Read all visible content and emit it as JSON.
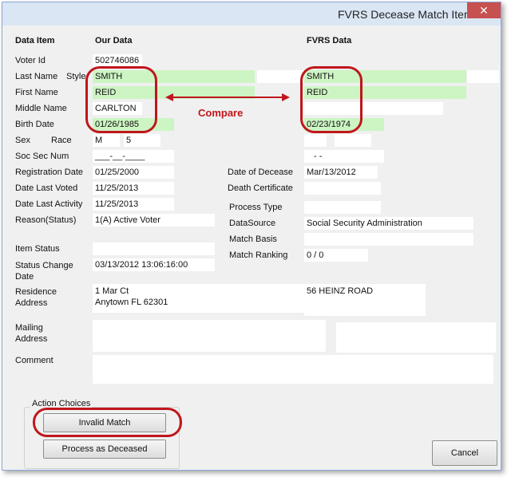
{
  "window": {
    "title": "FVRS Decease Match Item",
    "close_glyph": "✕"
  },
  "headers": {
    "data_item": "Data Item",
    "our_data": "Our Data",
    "fvrs_data": "FVRS Data"
  },
  "labels": {
    "voter_id": "Voter Id",
    "last_name": "Last Name",
    "style": "Style",
    "first_name": "First Name",
    "middle_name": "Middle Name",
    "birth_date": "Birth Date",
    "sex": "Sex",
    "race": "Race",
    "ssn": "Soc Sec Num",
    "registration_date": "Registration Date",
    "date_last_voted": "Date Last Voted",
    "date_last_activity": "Date Last Activity",
    "reason_status": "Reason(Status)",
    "item_status": "Item Status",
    "status_change_date": "Status Change Date",
    "residence_address": "Residence Address",
    "mailing_address": "Mailing Address",
    "comment": "Comment",
    "date_of_decease": "Date of Decease",
    "death_certificate": "Death Certificate",
    "process_type": "Process Type",
    "data_source": "DataSource",
    "match_basis": "Match Basis",
    "match_ranking": "Match Ranking"
  },
  "our": {
    "voter_id": "502746086",
    "last_name": "SMITH",
    "first_name": "REID",
    "middle_name": "CARLTON",
    "birth_date": "01/26/1985",
    "sex": "M",
    "race": "5",
    "ssn": "___-__-____",
    "registration_date": "01/25/2000",
    "date_last_voted": "11/25/2013",
    "date_last_activity": "11/25/2013",
    "reason_status": "1(A) Active Voter",
    "status_change_date": "03/13/2012 13:06:16:00",
    "residence_line1": "1 Mar Ct",
    "residence_line2": "Anytown FL 62301"
  },
  "fvrs": {
    "last_name": "SMITH",
    "first_name": "REID",
    "birth_date": "02/23/1974",
    "ssn": "-  -",
    "date_of_decease": "Mar/13/2012",
    "data_source": "Social Security Administration",
    "match_ranking": "0 / 0",
    "residence_address": "56 HEINZ ROAD"
  },
  "annotation": {
    "compare": "Compare"
  },
  "actions": {
    "group_label": "Action Choices",
    "invalid_match": "Invalid Match",
    "process_as_deceased": "Process as Deceased",
    "cancel": "Cancel"
  },
  "colors": {
    "match_green": "#ccf5c3",
    "annotation_red": "#c0161c"
  }
}
